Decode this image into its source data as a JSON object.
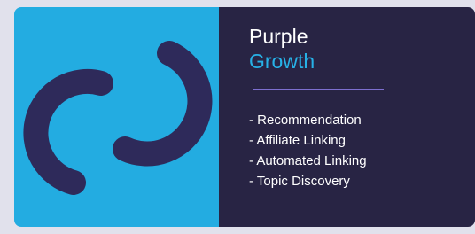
{
  "colors": {
    "page_background": "#e1e1ec",
    "logo_panel": "#23ace1",
    "logo_mark": "#2e2a5a",
    "info_panel": "#282444",
    "title_text": "#ffffff",
    "accent_text": "#27b1e6",
    "divider": "#7d6fd0"
  },
  "logo": {
    "icon": "purple-growth-logo-mark"
  },
  "brand": {
    "name": "Purple",
    "tag": "Growth"
  },
  "features": [
    "- Recommendation",
    "- Affiliate Linking",
    "- Automated Linking",
    "- Topic Discovery"
  ]
}
